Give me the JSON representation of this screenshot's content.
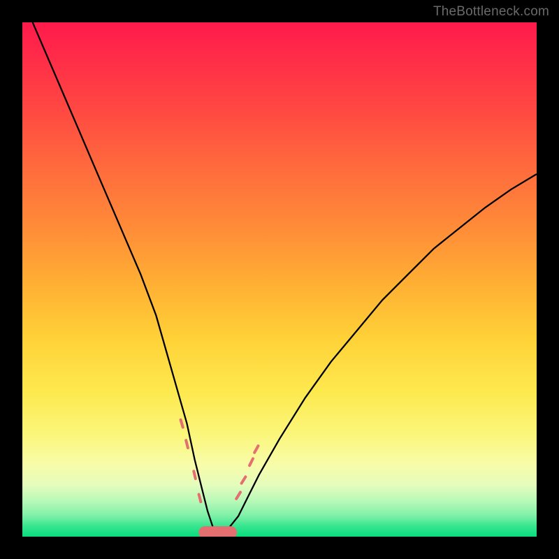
{
  "watermark": "TheBottleneck.com",
  "colors": {
    "page_bg": "#000000",
    "curve": "#000000",
    "marker": "#e46f70",
    "gradient_top": "#ff1a4c",
    "gradient_bottom": "#08dd7e"
  },
  "chart_data": {
    "type": "line",
    "title": "",
    "xlabel": "",
    "ylabel": "",
    "xlim": [
      0,
      100
    ],
    "ylim": [
      0,
      100
    ],
    "grid": false,
    "legend": null,
    "series": [
      {
        "name": "bottleneck-curve",
        "x": [
          2,
          5,
          8,
          11,
          14,
          17,
          20,
          23,
          26,
          28,
          30,
          32,
          33.5,
          35,
          36,
          37,
          38,
          39,
          40,
          42,
          44,
          46,
          50,
          55,
          60,
          65,
          70,
          75,
          80,
          85,
          90,
          95,
          100
        ],
        "y": [
          100,
          93,
          86,
          79,
          72,
          65,
          58,
          51,
          43,
          36,
          29,
          22,
          15,
          9,
          5,
          2,
          0.5,
          0.5,
          1.5,
          4,
          8,
          12,
          19,
          27,
          34,
          40,
          46,
          51,
          56,
          60,
          64,
          67.5,
          70.5
        ]
      }
    ],
    "markers": [
      {
        "x": 31.0,
        "y": 22.0
      },
      {
        "x": 32.0,
        "y": 18.0
      },
      {
        "x": 33.5,
        "y": 12.0
      },
      {
        "x": 34.5,
        "y": 7.5
      },
      {
        "x": 42.0,
        "y": 8.0
      },
      {
        "x": 43.0,
        "y": 11.0
      },
      {
        "x": 44.5,
        "y": 14.5
      },
      {
        "x": 45.5,
        "y": 17.0
      }
    ],
    "flat_segment": {
      "x_start": 35.5,
      "x_end": 40.5,
      "y": 0.8
    },
    "annotations": []
  }
}
